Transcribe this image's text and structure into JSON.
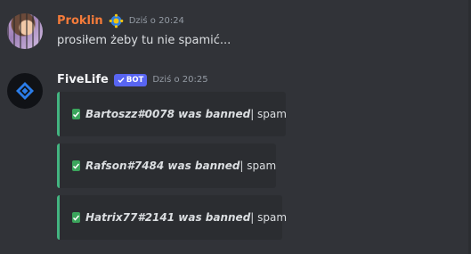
{
  "messages": [
    {
      "author": "Proklin",
      "timestamp": "Dziś o 20:24",
      "text": "prosiłem żeby tu nie spamić..."
    },
    {
      "author": "FiveLife",
      "bot_tag": "BOT",
      "timestamp": "Dziś o 20:25",
      "embeds": [
        {
          "bold": "Bartoszz#0078 was banned",
          "rest": " | spam"
        },
        {
          "bold": "Rafson#7484 was banned",
          "rest": " | spam"
        },
        {
          "bold": "Hatrix77#2141 was banned",
          "rest": " | spam"
        }
      ]
    }
  ],
  "colors": {
    "background": "#313338",
    "embed_background": "#2b2d31",
    "embed_accent": "#43b581",
    "user_name": "#f47b3a",
    "bot_tag": "#5865f2"
  },
  "icons": [
    "user-avatar",
    "server-badge-icon",
    "bot-avatar-diamond-icon",
    "verified-check-icon",
    "check-mark-icon"
  ]
}
